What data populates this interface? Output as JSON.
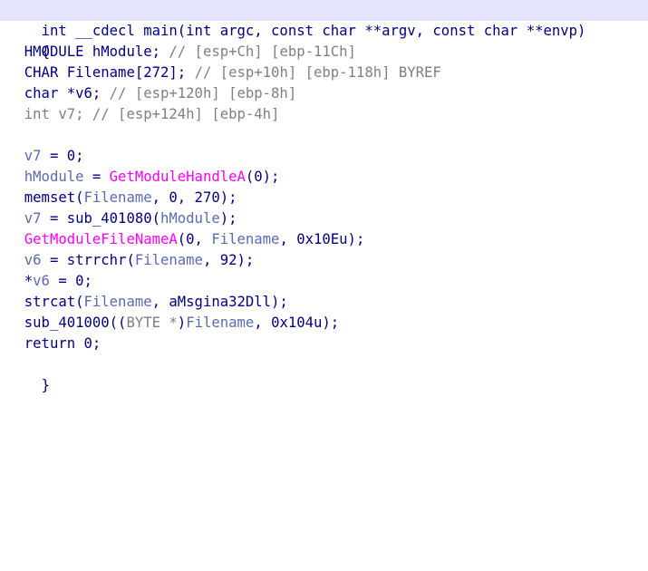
{
  "pseudocode": {
    "signature": "int __cdecl main(int argc, const char **argv, const char **envp)",
    "open_brace": "{",
    "close_brace": "}",
    "declarations": [
      {
        "type": "HMODULE hModule;",
        "comment": "// [esp+Ch] [ebp-11Ch]"
      },
      {
        "type": "CHAR Filename[272];",
        "comment": "// [esp+10h] [ebp-118h] BYREF"
      },
      {
        "type": "char *v6;",
        "comment": "// [esp+120h] [ebp-8h]"
      },
      {
        "type": "int v7;",
        "comment": "// [esp+124h] [ebp-4h]"
      }
    ],
    "statements": {
      "s1": {
        "lhs": "v7",
        "rest": " = 0;"
      },
      "s2": {
        "lhs": "hModule",
        "eq": " = ",
        "call": "GetModuleHandleA",
        "rest": "(0);"
      },
      "s3": {
        "fn": "memset(",
        "arg": "Filename",
        "rest": ", 0, 270);"
      },
      "s4": {
        "lhs": "v7",
        "mid": " = sub_401080(",
        "arg": "hModule",
        "rest": ");"
      },
      "s5": {
        "call": "GetModuleFileNameA",
        "mid": "(0, ",
        "arg": "Filename",
        "rest": ", 0x10Eu);"
      },
      "s6": {
        "lhs": "v6",
        "mid": " = strrchr(",
        "arg": "Filename",
        "rest": ", 92);"
      },
      "s7": {
        "star": "*",
        "lhs": "v6",
        "rest": " = 0;"
      },
      "s8": {
        "fn": "strcat(",
        "arg": "Filename",
        "rest": ", aMsgina32Dll);"
      },
      "s9": {
        "fn": "sub_401000((",
        "cast": "BYTE *",
        "close": ")",
        "arg": "Filename",
        "rest": ", 0x104u);"
      },
      "s10": {
        "text": "return 0;"
      }
    }
  }
}
